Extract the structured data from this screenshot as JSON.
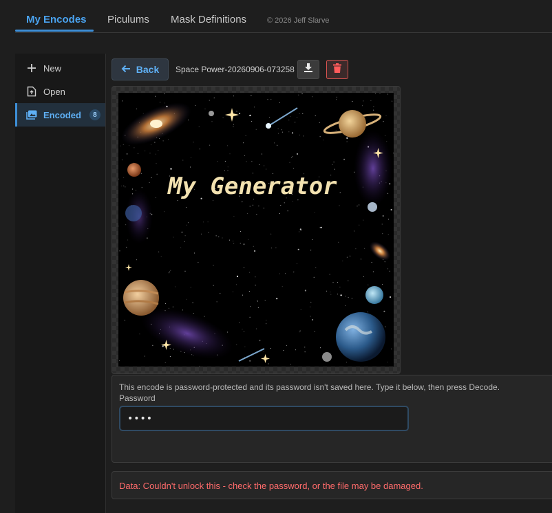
{
  "tabs": [
    {
      "label": "My Encodes",
      "active": true
    },
    {
      "label": "Piculums",
      "active": false
    },
    {
      "label": "Mask Definitions",
      "active": false
    }
  ],
  "copyright": "© 2026 Jeff Slarve",
  "sidebar": {
    "items": [
      {
        "label": "New",
        "icon": "plus-icon"
      },
      {
        "label": "Open",
        "icon": "open-file-icon"
      },
      {
        "label": "Encoded",
        "icon": "images-icon",
        "badge": "8",
        "active": true
      }
    ]
  },
  "toolbar": {
    "back_label": "Back",
    "filename": "Space Power-20260906-073258",
    "download_icon": "download-icon",
    "delete_icon": "trash-icon"
  },
  "image": {
    "title_text": "My Generator"
  },
  "password_panel": {
    "message": "This encode is password-protected and its password isn't saved here. Type it below, then press Decode.",
    "label": "Password",
    "value": "••••"
  },
  "error": {
    "text": "Data: Couldn't unlock this - check the password, or the file may be damaged."
  },
  "colors": {
    "accent": "#4aa3f0",
    "error": "#ff6b6b",
    "delete": "#d9534f"
  }
}
